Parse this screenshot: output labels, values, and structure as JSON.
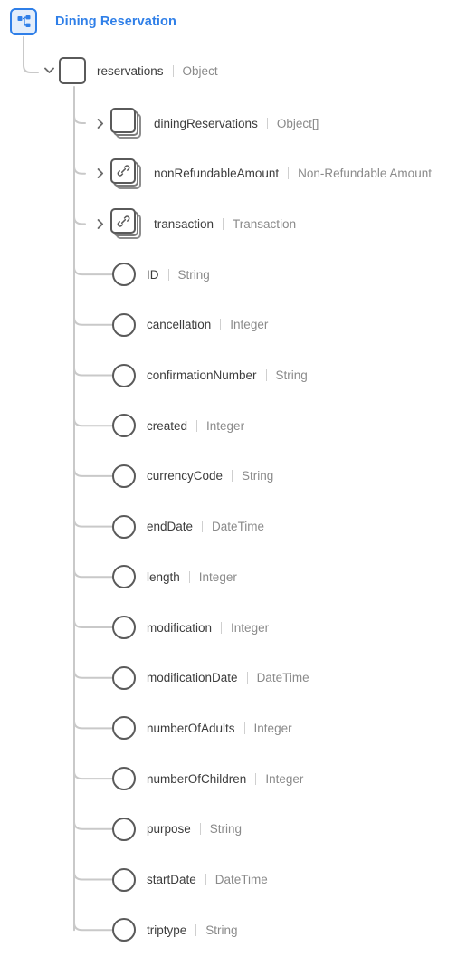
{
  "header": {
    "icon": "hierarchy-icon",
    "title": "Dining Reservation",
    "accent_color": "#2f7fe8"
  },
  "colors": {
    "accent": "#2f7fe8",
    "accent_fill": "#e4eefb",
    "node_stroke": "#5a5a5a",
    "connector": "#c9c9c9",
    "name_text": "#3c3c3c",
    "type_text": "#8a8a8a",
    "background": "#ffffff"
  },
  "tree": {
    "root": {
      "name": "reservations",
      "type": "Object",
      "glyph": "square",
      "toggle": "chevron-down-icon",
      "expanded": true
    },
    "children": [
      {
        "name": "diningReservations",
        "type": "Object[]",
        "glyph": "stack",
        "toggle": "chevron-right-icon",
        "expanded": false
      },
      {
        "name": "nonRefundableAmount",
        "type": "Non-Refundable Amount",
        "glyph": "stack-link",
        "toggle": "chevron-right-icon",
        "expanded": false
      },
      {
        "name": "transaction",
        "type": "Transaction",
        "glyph": "stack-link",
        "toggle": "chevron-right-icon",
        "expanded": false
      },
      {
        "name": "ID",
        "type": "String",
        "glyph": "circle",
        "toggle": "none",
        "expanded": false
      },
      {
        "name": "cancellation",
        "type": "Integer",
        "glyph": "circle",
        "toggle": "none",
        "expanded": false
      },
      {
        "name": "confirmationNumber",
        "type": "String",
        "glyph": "circle",
        "toggle": "none",
        "expanded": false
      },
      {
        "name": "created",
        "type": "Integer",
        "glyph": "circle",
        "toggle": "none",
        "expanded": false
      },
      {
        "name": "currencyCode",
        "type": "String",
        "glyph": "circle",
        "toggle": "none",
        "expanded": false
      },
      {
        "name": "endDate",
        "type": "DateTime",
        "glyph": "circle",
        "toggle": "none",
        "expanded": false
      },
      {
        "name": "length",
        "type": "Integer",
        "glyph": "circle",
        "toggle": "none",
        "expanded": false
      },
      {
        "name": "modification",
        "type": "Integer",
        "glyph": "circle",
        "toggle": "none",
        "expanded": false
      },
      {
        "name": "modificationDate",
        "type": "DateTime",
        "glyph": "circle",
        "toggle": "none",
        "expanded": false
      },
      {
        "name": "numberOfAdults",
        "type": "Integer",
        "glyph": "circle",
        "toggle": "none",
        "expanded": false
      },
      {
        "name": "numberOfChildren",
        "type": "Integer",
        "glyph": "circle",
        "toggle": "none",
        "expanded": false
      },
      {
        "name": "purpose",
        "type": "String",
        "glyph": "circle",
        "toggle": "none",
        "expanded": false
      },
      {
        "name": "startDate",
        "type": "DateTime",
        "glyph": "circle",
        "toggle": "none",
        "expanded": false
      },
      {
        "name": "triptype",
        "type": "String",
        "glyph": "circle",
        "toggle": "none",
        "expanded": false
      }
    ]
  }
}
